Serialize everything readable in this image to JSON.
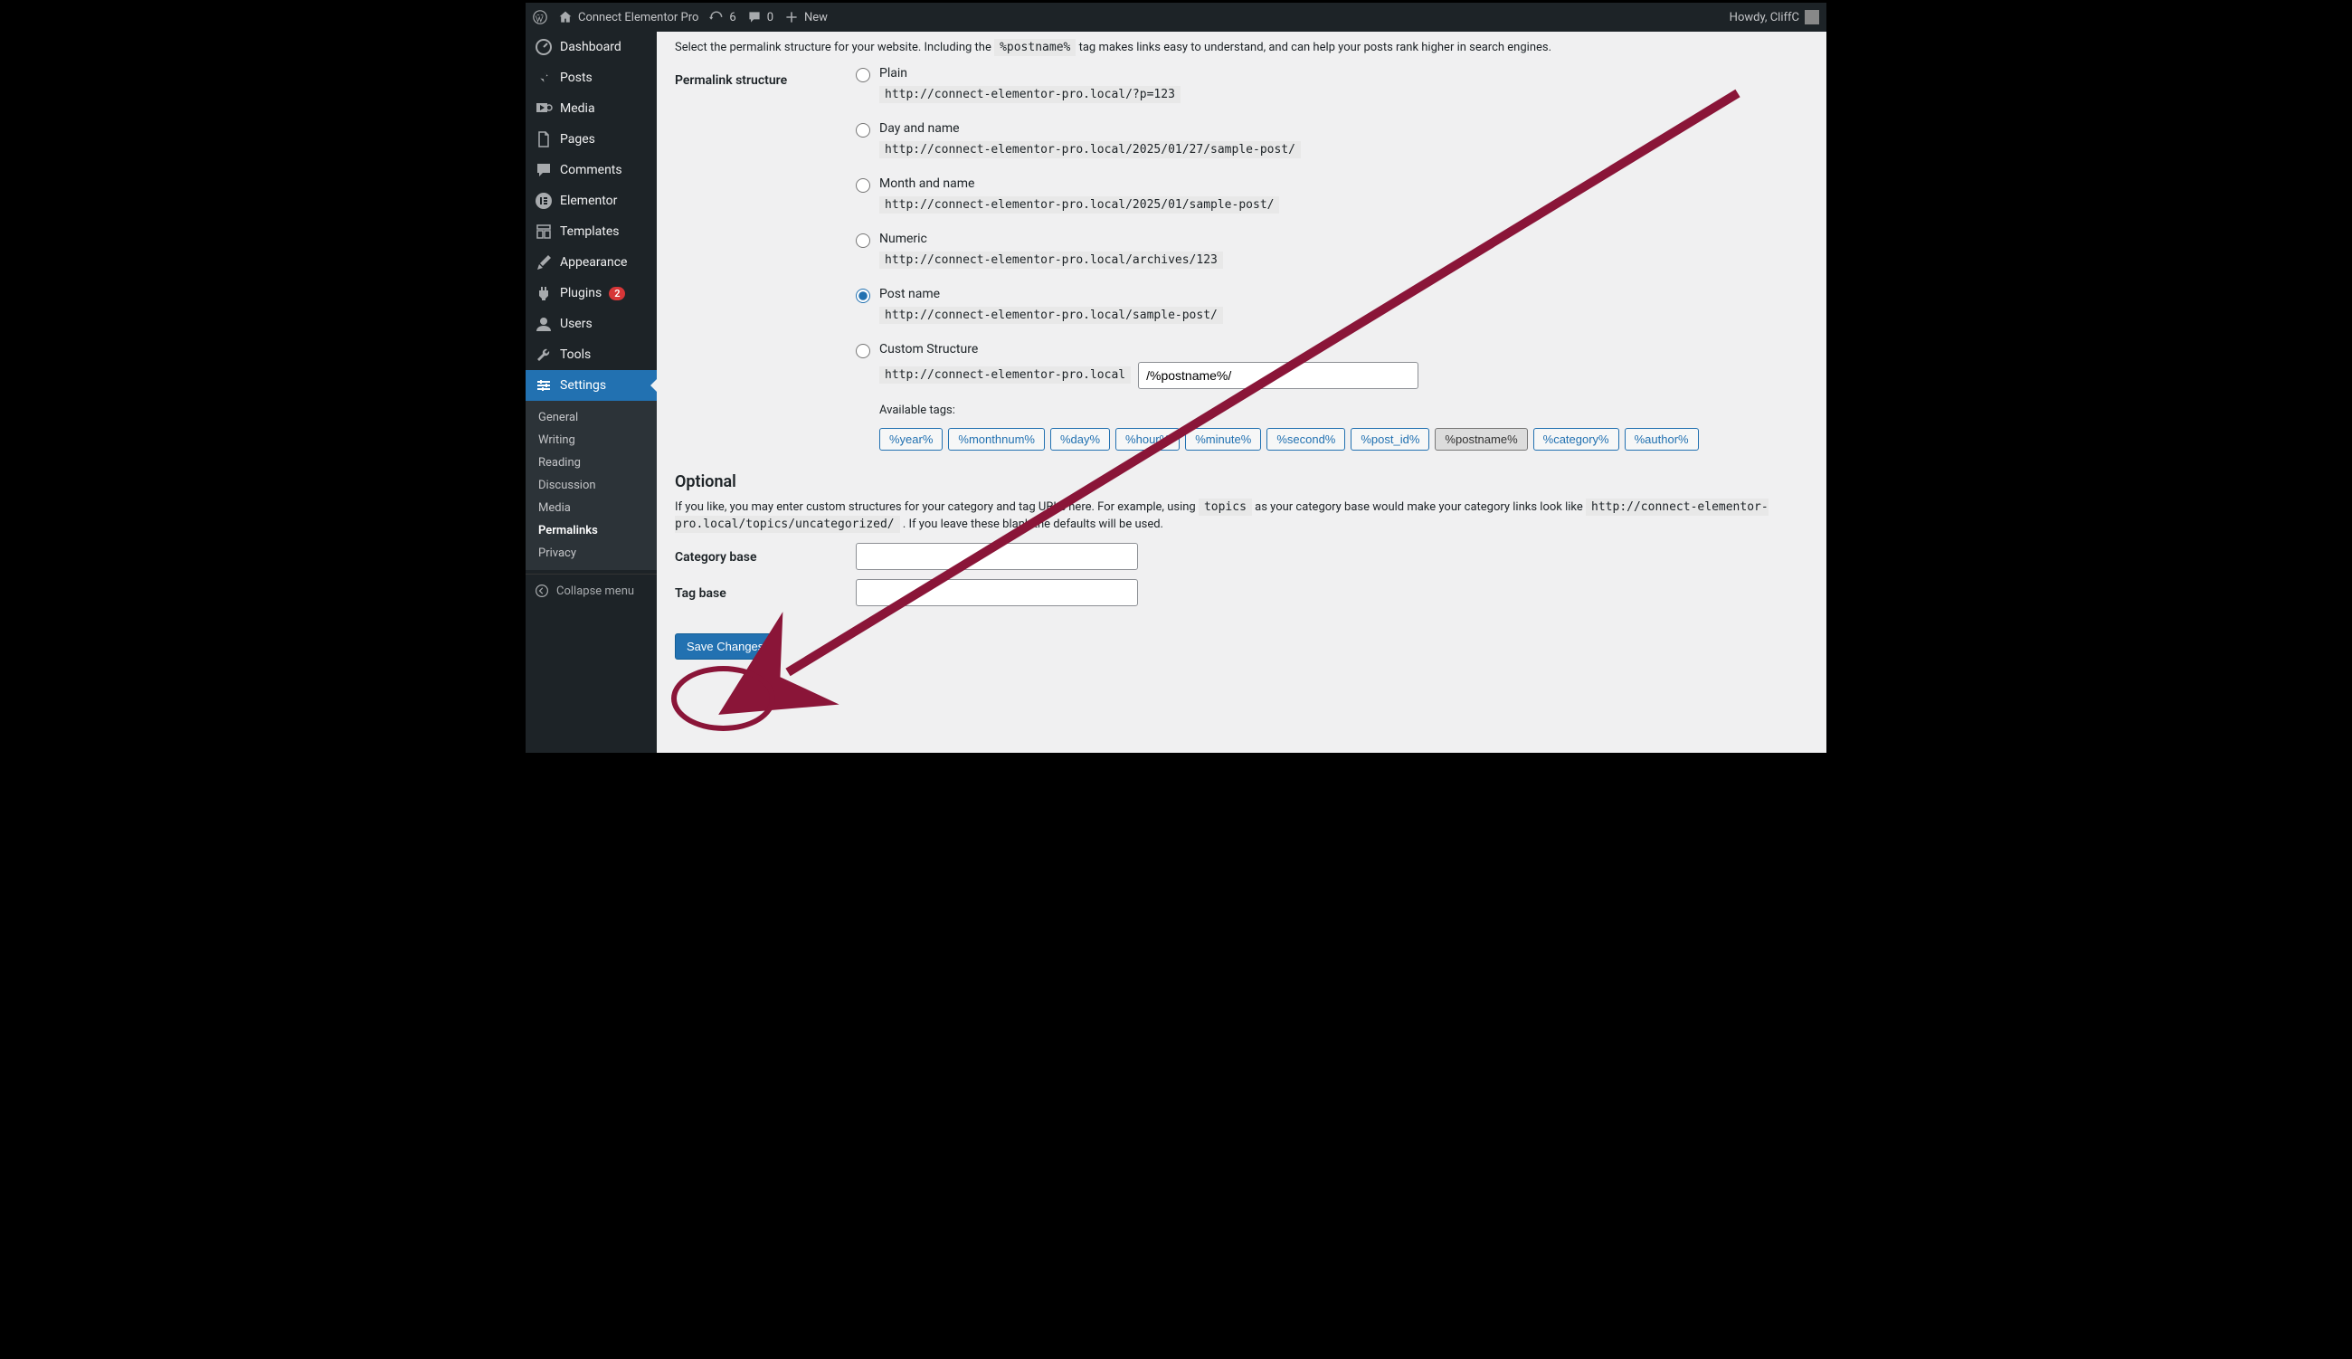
{
  "adminbar": {
    "site_title": "Connect Elementor Pro",
    "updates": "6",
    "comments": "0",
    "new_label": "New",
    "howdy": "Howdy, CliffC"
  },
  "sidebar": {
    "items": [
      {
        "label": "Dashboard"
      },
      {
        "label": "Posts"
      },
      {
        "label": "Media"
      },
      {
        "label": "Pages"
      },
      {
        "label": "Comments"
      },
      {
        "label": "Elementor"
      },
      {
        "label": "Templates"
      },
      {
        "label": "Appearance"
      },
      {
        "label": "Plugins",
        "badge": "2"
      },
      {
        "label": "Users"
      },
      {
        "label": "Tools"
      },
      {
        "label": "Settings"
      }
    ],
    "submenu": [
      {
        "label": "General"
      },
      {
        "label": "Writing"
      },
      {
        "label": "Reading"
      },
      {
        "label": "Discussion"
      },
      {
        "label": "Media"
      },
      {
        "label": "Permalinks"
      },
      {
        "label": "Privacy"
      }
    ],
    "collapse": "Collapse menu"
  },
  "content": {
    "intro_before": "Select the permalink structure for your website. Including the ",
    "intro_code": "%postname%",
    "intro_after": " tag makes links easy to understand, and can help your posts rank higher in search engines.",
    "permalink_label": "Permalink structure",
    "structures": [
      {
        "label": "Plain",
        "example": "http://connect-elementor-pro.local/?p=123"
      },
      {
        "label": "Day and name",
        "example": "http://connect-elementor-pro.local/2025/01/27/sample-post/"
      },
      {
        "label": "Month and name",
        "example": "http://connect-elementor-pro.local/2025/01/sample-post/"
      },
      {
        "label": "Numeric",
        "example": "http://connect-elementor-pro.local/archives/123"
      },
      {
        "label": "Post name",
        "example": "http://connect-elementor-pro.local/sample-post/"
      },
      {
        "label": "Custom Structure"
      }
    ],
    "selected_structure_index": 4,
    "custom_prefix": "http://connect-elementor-pro.local",
    "custom_value": "/%postname%/",
    "available_tags_label": "Available tags:",
    "tags": [
      "%year%",
      "%monthnum%",
      "%day%",
      "%hour%",
      "%minute%",
      "%second%",
      "%post_id%",
      "%postname%",
      "%category%",
      "%author%"
    ],
    "selected_tag_index": 7,
    "optional_heading": "Optional",
    "optional_before": "If you like, you may enter custom structures for your category and tag URLs here. For example, using ",
    "optional_code1": "topics",
    "optional_mid": " as your category base would make your category links look like ",
    "optional_code2": "http://connect-elementor-pro.local/topics/uncategorized/",
    "optional_after": " . If you leave these blank the defaults will be used.",
    "category_base_label": "Category base",
    "tag_base_label": "Tag base",
    "save_label": "Save Changes"
  }
}
